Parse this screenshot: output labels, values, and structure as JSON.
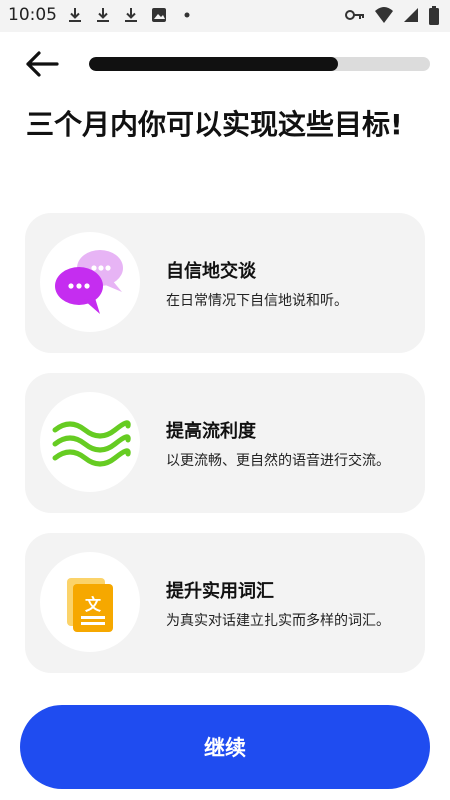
{
  "status_bar": {
    "time": "10:05",
    "left_icons": [
      "download-icon",
      "download-icon",
      "download-icon",
      "image-icon",
      "dot-icon"
    ],
    "right_icons": [
      "key-icon",
      "wifi-icon",
      "signal-icon",
      "battery-icon"
    ]
  },
  "header": {
    "progress_percent": 73
  },
  "page": {
    "title": "三个月内你可以实现这些目标!"
  },
  "goals": [
    {
      "title": "自信地交谈",
      "description": "在日常情况下自信地说和听。",
      "icon": "chat-bubbles-icon"
    },
    {
      "title": "提高流利度",
      "description": "以更流畅、更自然的语音进行交流。",
      "icon": "waves-icon"
    },
    {
      "title": "提升实用词汇",
      "description": "为真实对话建立扎实而多样的词汇。",
      "icon": "vocabulary-document-icon"
    }
  ],
  "icon_glyphs": {
    "vocabulary_char": "文"
  },
  "footer": {
    "continue_label": "继续"
  },
  "colors": {
    "accent": "#1f4cf0",
    "progress_fill": "#111111",
    "card_bg": "#f3f3f3",
    "chat_purple": "#c52df0",
    "chat_pink": "#e7b4f5",
    "wave_green": "#66cc22",
    "doc_orange": "#f6a800"
  }
}
